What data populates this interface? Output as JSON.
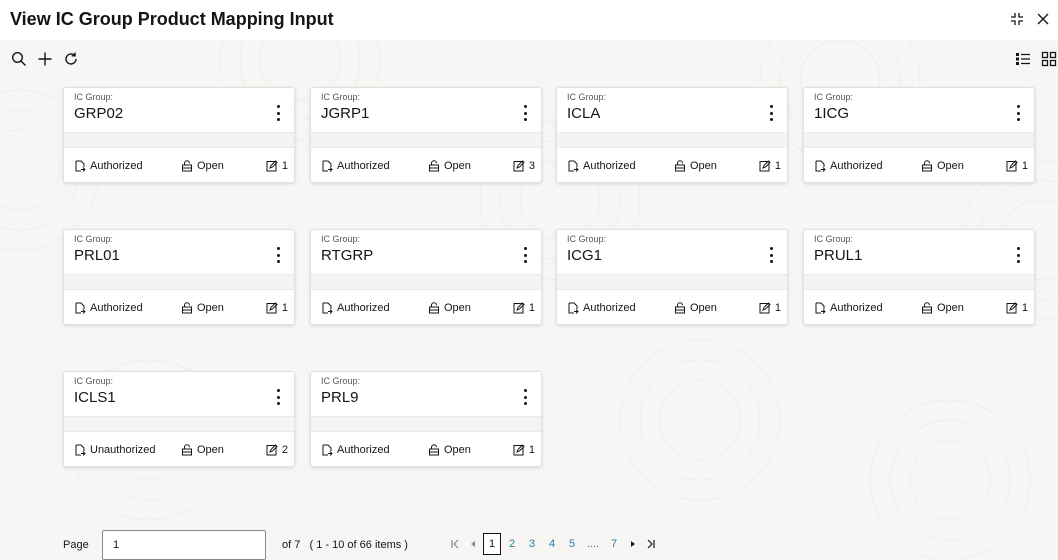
{
  "window": {
    "title": "View IC Group Product Mapping Input"
  },
  "icons": {
    "search": "search-icon",
    "add": "plus-icon",
    "refresh": "refresh-icon",
    "list_view": "list-view-icon",
    "grid_view": "grid-view-icon",
    "minimize": "minimize-icon",
    "close": "close-icon"
  },
  "cards": [
    {
      "label": "IC Group:",
      "value": "GRP02",
      "status": "Authorized",
      "open": "Open",
      "mods": "1"
    },
    {
      "label": "IC Group:",
      "value": "JGRP1",
      "status": "Authorized",
      "open": "Open",
      "mods": "3"
    },
    {
      "label": "IC Group:",
      "value": "ICLA",
      "status": "Authorized",
      "open": "Open",
      "mods": "1"
    },
    {
      "label": "IC Group:",
      "value": "1ICG",
      "status": "Authorized",
      "open": "Open",
      "mods": "1"
    },
    {
      "label": "IC Group:",
      "value": "PRL01",
      "status": "Authorized",
      "open": "Open",
      "mods": "1"
    },
    {
      "label": "IC Group:",
      "value": "RTGRP",
      "status": "Authorized",
      "open": "Open",
      "mods": "1"
    },
    {
      "label": "IC Group:",
      "value": "ICG1",
      "status": "Authorized",
      "open": "Open",
      "mods": "1"
    },
    {
      "label": "IC Group:",
      "value": "PRUL1",
      "status": "Authorized",
      "open": "Open",
      "mods": "1"
    },
    {
      "label": "IC Group:",
      "value": "ICLS1",
      "status": "Unauthorized",
      "open": "Open",
      "mods": "2"
    },
    {
      "label": "IC Group:",
      "value": "PRL9",
      "status": "Authorized",
      "open": "Open",
      "mods": "1"
    }
  ],
  "pagination": {
    "page_label": "Page",
    "page_value": "1",
    "of_text": "of 7",
    "range_text": "( 1 - 10 of 66 items )",
    "pages": [
      "1",
      "2",
      "3",
      "4",
      "5"
    ],
    "ellipsis": "....",
    "last_page": "7",
    "current_page": "1"
  },
  "colors": {
    "link": "#227e9e",
    "text": "#161513",
    "background": "#f7f6f4"
  }
}
